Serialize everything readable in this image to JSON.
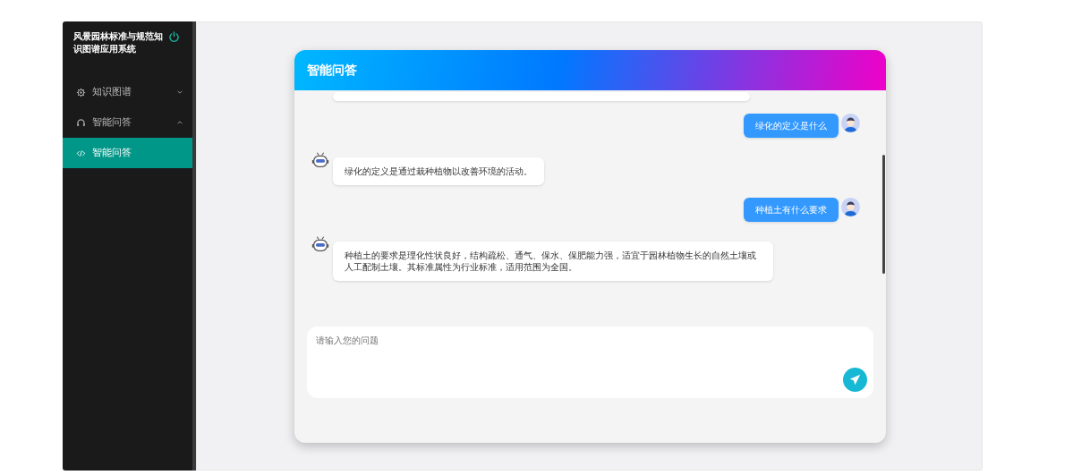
{
  "sidebar": {
    "title": "风景园林标准与规范知识图谱应用系统",
    "items": [
      {
        "label": "知识图谱",
        "kind": "gear",
        "expanded": false,
        "selected": false
      },
      {
        "label": "智能问答",
        "kind": "headset",
        "expanded": true,
        "selected": false,
        "children": [
          {
            "label": "智能问答",
            "kind": "code",
            "selected": true
          }
        ]
      }
    ]
  },
  "chat": {
    "title": "智能问答",
    "messages": [
      {
        "kind": "bot-cut"
      },
      {
        "kind": "user",
        "text": "绿化的定义是什么"
      },
      {
        "kind": "bot",
        "text": "绿化的定义是通过栽种植物以改善环境的活动。"
      },
      {
        "kind": "user",
        "text": "种植土有什么要求"
      },
      {
        "kind": "bot",
        "text": "种植土的要求是理化性状良好，结构疏松、通气、保水、保肥能力强，适宜于园林植物生长的自然土壤或人工配制土壤。其标准属性为行业标准，适用范围为全国。"
      }
    ],
    "input": {
      "placeholder": "请输入您的问题"
    }
  }
}
